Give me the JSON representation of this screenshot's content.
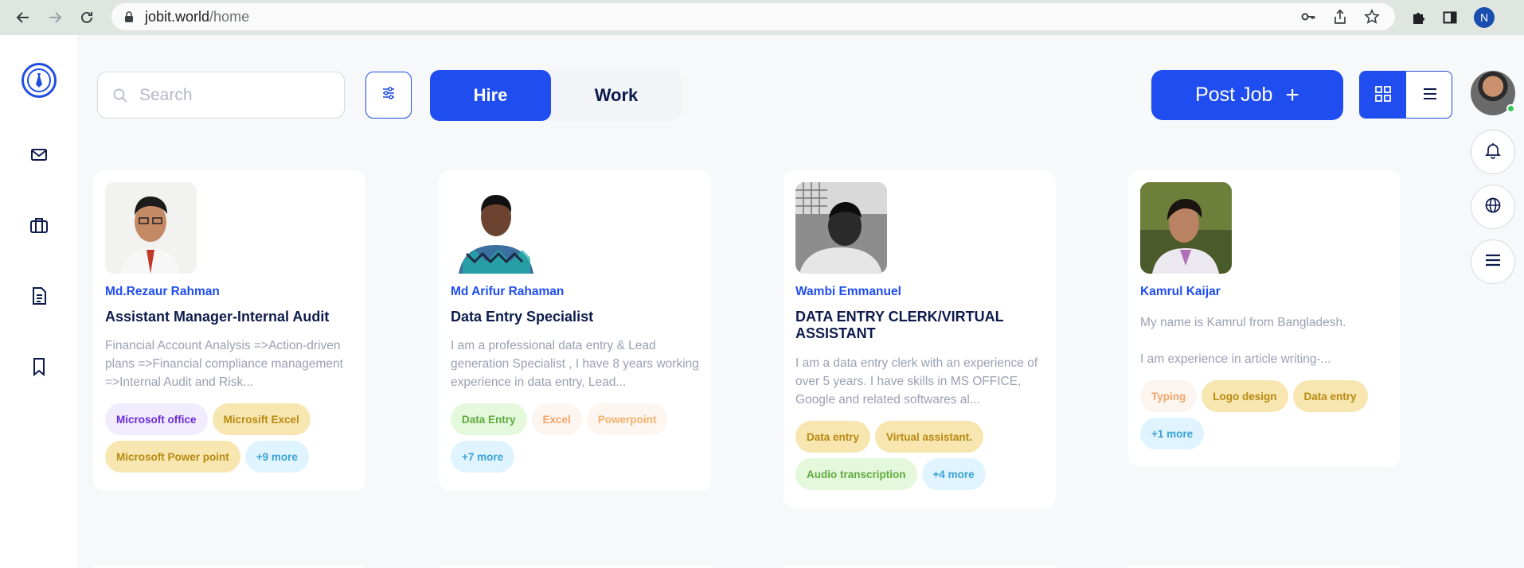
{
  "browser": {
    "url_host": "jobit.world",
    "url_path": "/home",
    "profile_initial": "N"
  },
  "topbar": {
    "search_placeholder": "Search",
    "hire_label": "Hire",
    "work_label": "Work",
    "post_job_label": "Post Job",
    "post_job_plus": "+"
  },
  "cards": [
    {
      "name": "Md.Rezaur Rahman",
      "title": "Assistant Manager-Internal Audit",
      "description": "Financial Account Analysis =>Action-driven plans =>Financial compliance management =>Internal Audit and Risk...",
      "tags": [
        "Microsoft office",
        "Microsift Excel",
        "Microsoft Power point",
        "+9 more"
      ]
    },
    {
      "name": "Md Arifur Rahaman",
      "title": "Data Entry Specialist",
      "description": "I am a professional data entry & Lead generation Specialist , I have 8 years working experience in data entry, Lead...",
      "tags": [
        "Data Entry",
        "Excel",
        "Powerpoint",
        "+7 more"
      ]
    },
    {
      "name": "Wambi Emmanuel",
      "title": "DATA ENTRY CLERK/VIRTUAL ASSISTANT",
      "description": "I am a data entry clerk with an experience of over 5 years. I have skills in MS OFFICE, Google and related softwares al...",
      "tags": [
        "Data entry",
        "Virtual assistant.",
        "Audio transcription",
        "+4 more"
      ]
    },
    {
      "name": "Kamrul Kaijar",
      "title": "",
      "description_line1": "My name is Kamrul from Bangladesh.",
      "description_line2": "I am experience in article writing-...",
      "tags": [
        "Typing",
        "Logo design",
        "Data entry",
        "+1 more"
      ]
    }
  ]
}
